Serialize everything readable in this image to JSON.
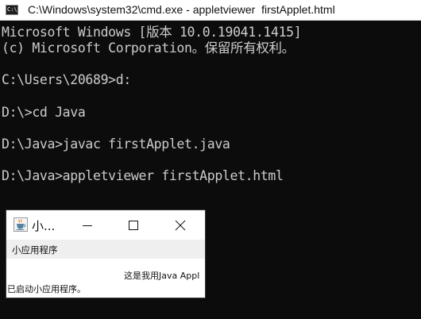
{
  "cmd_window": {
    "icon_text": "C:\\.",
    "title": "C:\\Windows\\system32\\cmd.exe - appletviewer  firstApplet.html"
  },
  "console": {
    "lines": [
      "Microsoft Windows [版本 10.0.19041.1415]",
      "(c) Microsoft Corporation。保留所有权利。",
      "",
      "C:\\Users\\20689>d:",
      "",
      "D:\\>cd Java",
      "",
      "D:\\Java>javac firstApplet.java",
      "",
      "D:\\Java>appletviewer firstApplet.html"
    ]
  },
  "applet_window": {
    "title": "小...",
    "menu_label": "小应用程序",
    "canvas_text": "这是我用Java Appl",
    "status_text": "已启动小应用程序。",
    "icons": {
      "app": "java-cup-icon",
      "minimize": "minimize-icon",
      "maximize": "maximize-icon",
      "close": "close-icon"
    }
  }
}
